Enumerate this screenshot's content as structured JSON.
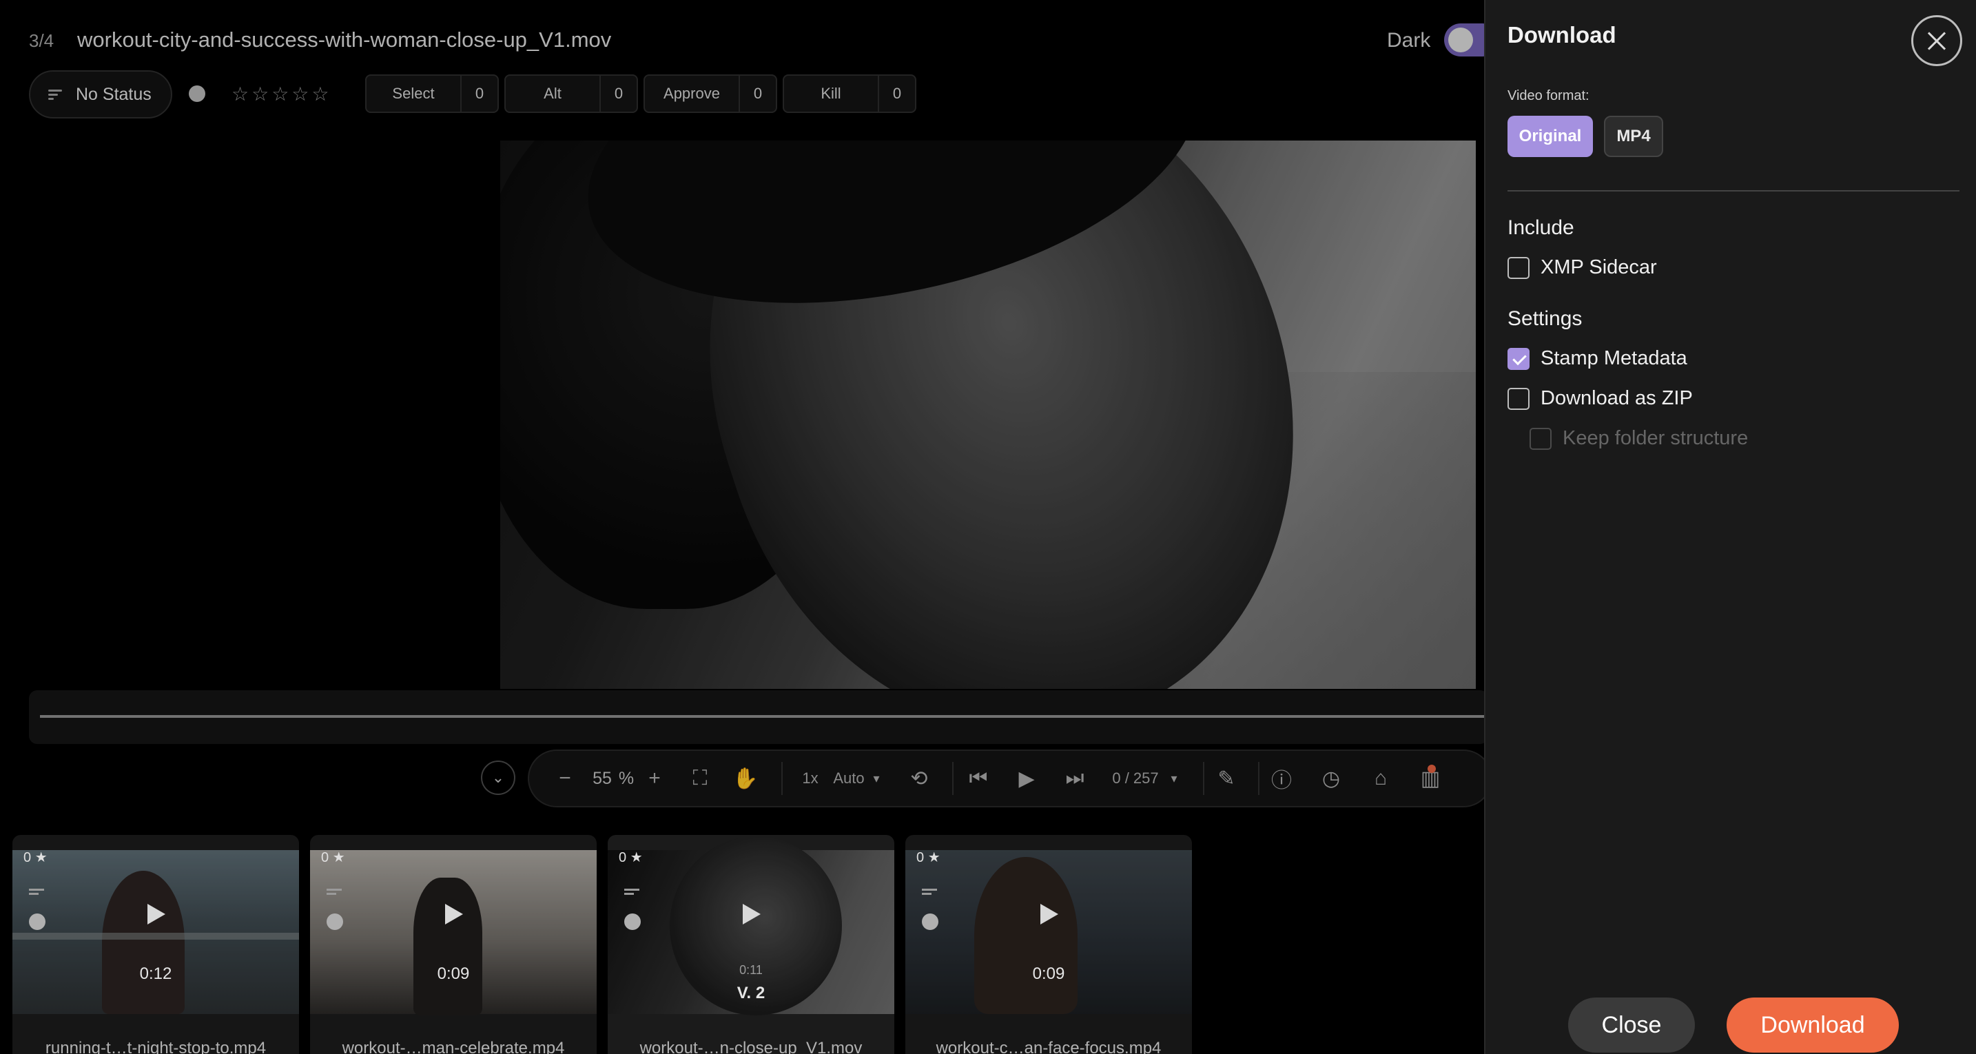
{
  "header": {
    "counter": "3/4",
    "filename": "workout-city-and-success-with-woman-close-up_V1.mov",
    "theme_label": "Dark"
  },
  "toolbar_top": {
    "status_label": "No Status",
    "groups": [
      {
        "label": "Select",
        "count": "0"
      },
      {
        "label": "Alt",
        "count": "0"
      },
      {
        "label": "Approve",
        "count": "0"
      },
      {
        "label": "Kill",
        "count": "0"
      }
    ],
    "stars": "☆☆☆☆☆"
  },
  "player": {
    "zoom_minus": "−",
    "zoom_value": "55",
    "zoom_unit": "%",
    "zoom_plus": "+",
    "speed": "1x",
    "quality": "Auto",
    "frame_counter": "0 / 257"
  },
  "filmstrip": [
    {
      "rating": "0",
      "duration": "0:12",
      "version": "",
      "name": "running-t…t-night-stop-to.mp4"
    },
    {
      "rating": "0",
      "duration": "0:09",
      "version": "",
      "name": "workout-…man-celebrate.mp4"
    },
    {
      "rating": "0",
      "duration": "0:11",
      "version": "V. 2",
      "name": "workout-…n-close-up_V1.mov"
    },
    {
      "rating": "0",
      "duration": "0:09",
      "version": "",
      "name": "workout-c…an-face-focus.mp4"
    }
  ],
  "download_panel": {
    "title": "Download",
    "video_format_label": "Video format:",
    "formats": [
      "Original",
      "MP4"
    ],
    "selected_format": "Original",
    "include_heading": "Include",
    "xmp_label": "XMP Sidecar",
    "settings_heading": "Settings",
    "stamp_label": "Stamp Metadata",
    "zip_label": "Download as ZIP",
    "keep_label": "Keep folder structure",
    "close_label": "Close",
    "download_label": "Download"
  },
  "colors": {
    "accent": "#a591e0",
    "download": "#ef6a42",
    "panel_bg": "#1a1a1a"
  }
}
